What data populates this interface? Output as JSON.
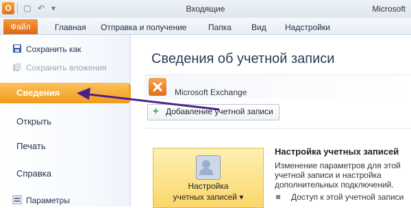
{
  "window": {
    "title": "Входящие",
    "app_name": "Microsoft",
    "app_icon_letter": "O"
  },
  "ribbon": {
    "tabs": [
      "Файл",
      "Главная",
      "Отправка и получение",
      "Папка",
      "Вид",
      "Надстройки"
    ]
  },
  "nav": {
    "save_as": "Сохранить как",
    "save_attachments": "Сохранить вложения",
    "items": [
      "Сведения",
      "Открыть",
      "Печать",
      "Справка",
      "Параметры"
    ],
    "active_item": "Сведения"
  },
  "main": {
    "title": "Сведения об учетной записи",
    "account": "Microsoft Exchange",
    "add_account_button": "Добавление учетной записи",
    "settings_card": {
      "line1": "Настройка",
      "line2": "учетных записей ▾"
    },
    "settings_info": {
      "title": "Настройка учетных записей",
      "desc": [
        "Изменение параметров для этой",
        "учетной записи и настройка",
        "дополнительных подключений."
      ],
      "bullet": "Доступ к этой учетной записи"
    }
  },
  "colors": {
    "accent_orange": "#f29a1d",
    "annotation_arrow": "#4b1f8a"
  }
}
